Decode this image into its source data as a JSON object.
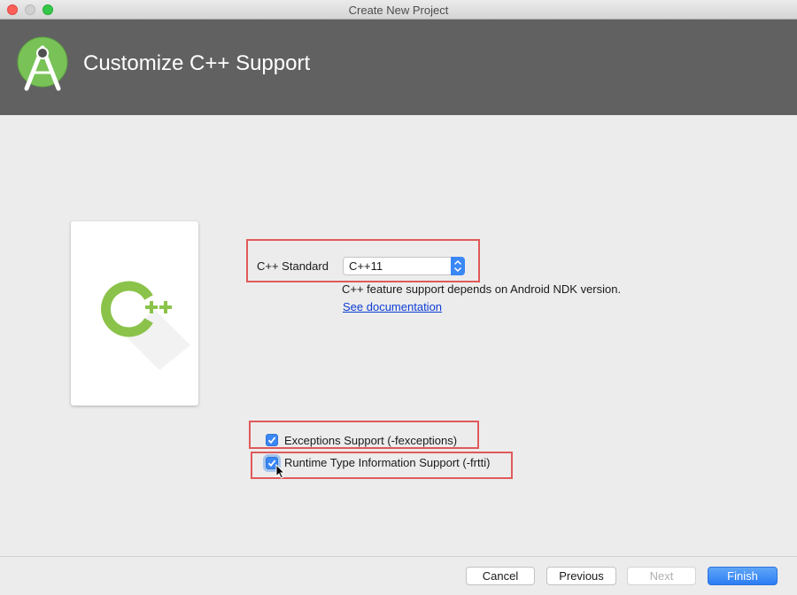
{
  "window": {
    "title": "Create New Project"
  },
  "header": {
    "title": "Customize C++ Support",
    "logo_icon": "android-studio-logo-icon"
  },
  "card": {
    "icon": "cpp-logo-icon"
  },
  "cpp_standard": {
    "label": "C++ Standard",
    "selected": "C++11",
    "note": "C++ feature support depends on Android NDK version.",
    "link": "See documentation"
  },
  "options": {
    "exceptions": {
      "label": "Exceptions Support (-fexceptions)",
      "checked": true
    },
    "rtti": {
      "label": "Runtime Type Information Support (-frtti)",
      "checked": true
    }
  },
  "footer": {
    "cancel": "Cancel",
    "previous": "Previous",
    "next": "Next",
    "finish": "Finish"
  },
  "colors": {
    "header_bg": "#616161",
    "accent": "#3a87f5",
    "highlight_box": "#e05a5a",
    "cpp_green": "#8bc34a"
  }
}
